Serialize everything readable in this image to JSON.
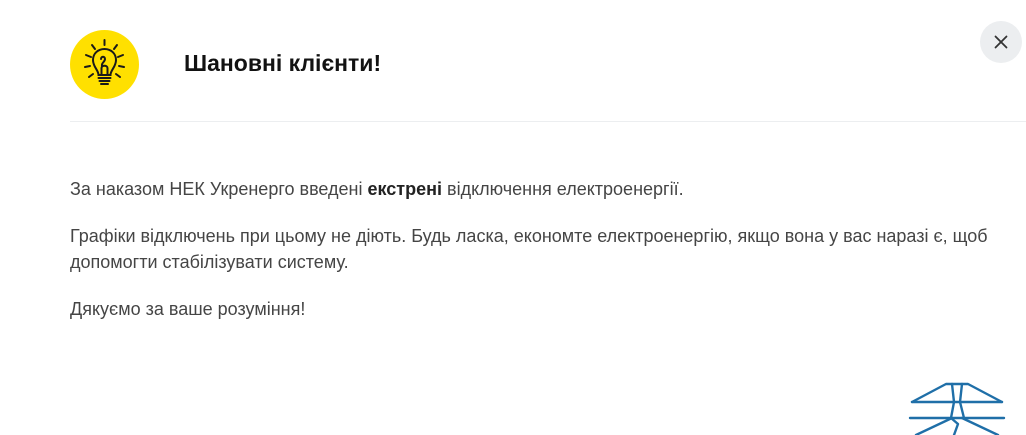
{
  "dialog": {
    "title": "Шановні клієнти!",
    "paragraph1": {
      "before": "За наказом НЕК Укренерго введені ",
      "emphasis": "екстрені",
      "after": " відключення електроенергії."
    },
    "paragraph2": "Графіки відключень при цьому не діють.  Будь ласка, економте електроенергію, якщо вона у вас наразі є, щоб допомогти стабілізувати систему.",
    "paragraph3": "Дякуємо за ваше розуміння!"
  },
  "icons": {
    "header": "lightbulb-icon",
    "close": "close-icon",
    "logo": "power-pylon-logo-icon"
  },
  "colors": {
    "bulb_background": "#ffe000",
    "close_background": "#eceef0",
    "title": "#121212",
    "body_text": "#454545",
    "logo": "#1f6fa8"
  }
}
